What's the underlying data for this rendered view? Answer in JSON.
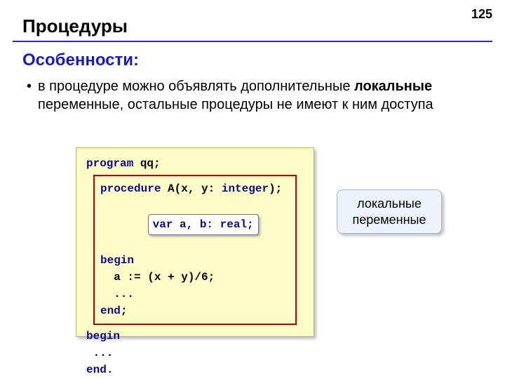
{
  "page_number": "125",
  "title": "Процедуры",
  "subtitle": "Особенности:",
  "bullet": {
    "before": "в процедуре можно объявлять дополнительные ",
    "strong": "локальные",
    "after": " переменные, остальные процедуры не имеют к ним доступа"
  },
  "code": {
    "kw_program": "program",
    "prog_name": " qq;",
    "kw_procedure": "procedure",
    "proc_sig_mid": " A(x, y: ",
    "kw_int": "integer",
    "proc_sig_end": ");",
    "var_decl_kw": "var",
    "var_decl_rest": " a, b: real;",
    "kw_begin_inner": "begin",
    "body1": "  a := (x + y)/6;",
    "body2": "  ...",
    "kw_end_inner": "end",
    "end_inner_semi": ";",
    "kw_begin_outer": "begin",
    "outer_body": " ...",
    "kw_end_outer": "end",
    "end_outer_dot": "."
  },
  "callout": {
    "l1": "локальные",
    "l2": "переменные"
  }
}
